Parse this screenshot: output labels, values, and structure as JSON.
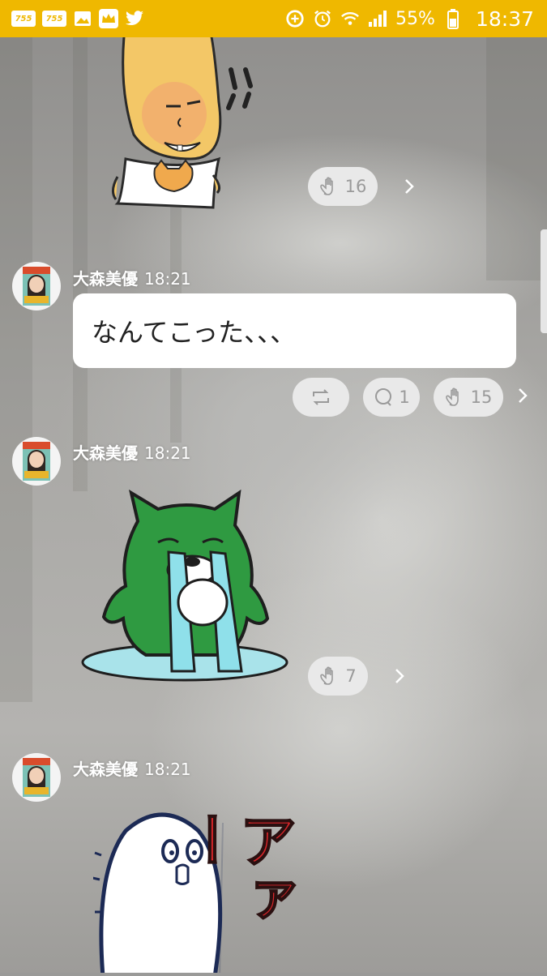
{
  "status_bar": {
    "notif_app_1": "755",
    "notif_app_2": "755",
    "battery_percent": "55%",
    "time": "18:37"
  },
  "messages": [
    {
      "type": "sticker",
      "sticker": "potato-character-sticker",
      "reactions": {
        "clap_count": "16"
      }
    },
    {
      "type": "text",
      "sender": "大森美優",
      "time": "18:21",
      "text": "なんてこった、、、",
      "reactions": {
        "comment_count": "1",
        "clap_count": "15"
      }
    },
    {
      "type": "sticker",
      "sender": "大森美優",
      "time": "18:21",
      "sticker": "green-bear-crying-sticker",
      "reactions": {
        "clap_count": "7"
      }
    },
    {
      "type": "sticker",
      "sender": "大森美優",
      "time": "18:21",
      "sticker": "white-ghost-scream-sticker",
      "sticker_text": "アァー"
    }
  ]
}
